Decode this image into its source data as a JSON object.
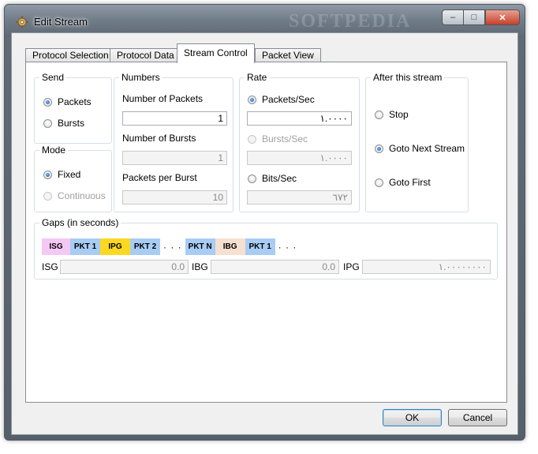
{
  "window": {
    "title": "Edit Stream",
    "watermark": "SOFTPEDIA"
  },
  "title_buttons": {
    "minimize": "–",
    "maximize": "□",
    "close": "✕"
  },
  "tabs": [
    {
      "label": "Protocol Selection",
      "active": false
    },
    {
      "label": "Protocol Data",
      "active": false
    },
    {
      "label": "Stream Control",
      "active": true
    },
    {
      "label": "Packet View",
      "active": false
    }
  ],
  "send": {
    "legend": "Send",
    "options": [
      {
        "label": "Packets",
        "checked": true
      },
      {
        "label": "Bursts",
        "checked": false
      }
    ]
  },
  "mode": {
    "legend": "Mode",
    "options": [
      {
        "label": "Fixed",
        "checked": true
      },
      {
        "label": "Continuous",
        "checked": false,
        "disabled": true
      }
    ]
  },
  "numbers": {
    "legend": "Numbers",
    "num_packets_label": "Number of Packets",
    "num_packets_value": "1",
    "num_bursts_label": "Number of Bursts",
    "num_bursts_value": "1",
    "packets_per_burst_label": "Packets per Burst",
    "packets_per_burst_value": "10"
  },
  "rate": {
    "legend": "Rate",
    "packets_sec_label": "Packets/Sec",
    "packets_sec_value": "١.٠٠٠٠",
    "bursts_sec_label": "Bursts/Sec",
    "bursts_sec_value": "١.٠٠٠٠",
    "bits_sec_label": "Bits/Sec",
    "bits_sec_value": "٦٧٢"
  },
  "after_stream": {
    "legend": "After this stream",
    "options": [
      {
        "label": "Stop",
        "checked": false
      },
      {
        "label": "Goto Next Stream",
        "checked": true
      },
      {
        "label": "Goto First",
        "checked": false
      }
    ]
  },
  "gaps": {
    "legend": "Gaps (in seconds)",
    "cells": [
      {
        "label": "ISG",
        "color": "#f4c8f4"
      },
      {
        "label": "PKT 1",
        "color": "#a8ccf4"
      },
      {
        "label": "IPG",
        "color": "#fcd820"
      },
      {
        "label": "PKT 2",
        "color": "#a8ccf4"
      },
      {
        "label": "PKT N",
        "color": "#a8ccf4"
      },
      {
        "label": "IBG",
        "color": "#f6e0d0"
      },
      {
        "label": "PKT 1",
        "color": "#a8ccf4"
      }
    ],
    "dots": "· · ·",
    "isg_label": "ISG",
    "isg_value": "0.0",
    "ibg_label": "IBG",
    "ibg_value": "0.0",
    "ipg_label": "IPG",
    "ipg_value": "١.٠٠٠٠٠٠٠٠"
  },
  "buttons": {
    "ok": "OK",
    "cancel": "Cancel"
  }
}
